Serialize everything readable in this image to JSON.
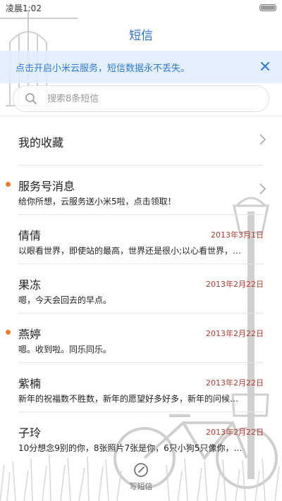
{
  "status_bar": {
    "time": "凌晨1:02"
  },
  "header": {
    "title": "短信"
  },
  "banner": {
    "text": "点击开启小米云服务，短信数据永不丢失。",
    "close_icon": "close-icon"
  },
  "search": {
    "placeholder": "搜索8条短信",
    "icon": "search-icon"
  },
  "colors": {
    "accent": "#2a6fd6",
    "banner_bg": "#e2eefc",
    "date": "#b23a2e",
    "unread": "#f07b2a"
  },
  "conversations": [
    {
      "title": "我的收藏",
      "preview": "",
      "date": "",
      "unread": false,
      "chevron": true
    },
    {
      "title": "服务号消息",
      "preview": "给你所想，云服务送小米5啦，点击领取！",
      "date": "",
      "unread": true,
      "chevron": true
    },
    {
      "title": "倩倩",
      "preview": "以眼看世界，即使站的最高，世界还是很小;以心看世界，…",
      "date": "2013年3月1日",
      "unread": false,
      "chevron": false
    },
    {
      "title": "果冻",
      "preview": "嗯，今天会回去的早点。",
      "date": "2013年2月22日",
      "unread": false,
      "chevron": false
    },
    {
      "title": "燕婷",
      "preview": "嗯。收到啦。同乐同乐。",
      "date": "2013年2月22日",
      "unread": true,
      "chevron": false
    },
    {
      "title": "紫楠",
      "preview": "新年的祝福数不胜数，新年的愿望好多好多，新年的问候…",
      "date": "2013年2月22日",
      "unread": false,
      "chevron": false
    },
    {
      "title": "子玲",
      "preview": "10分想念9别的你，8张照片7张是你，6只小狗5只像你，…",
      "date": "2013年2月22日",
      "unread": false,
      "chevron": false
    }
  ],
  "compose": {
    "label": "写短信",
    "icon": "compose-icon"
  }
}
